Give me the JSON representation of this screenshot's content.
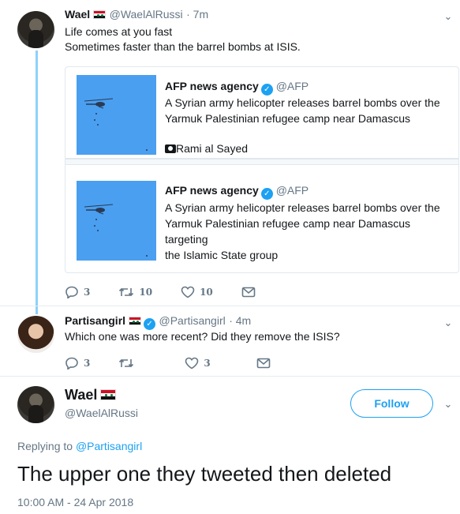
{
  "tweet1": {
    "name": "Wael",
    "handle": "@WaelAlRussi",
    "time": "· 7m",
    "lines": [
      "Life comes at you fast",
      "Sometimes faster than the barrel bombs at ISIS."
    ],
    "actions": {
      "reply": "3",
      "retweet": "10",
      "like": "10"
    }
  },
  "embed": {
    "card1": {
      "name": "AFP news agency",
      "handle": "@AFP",
      "lines": [
        "A Syrian army helicopter releases barrel bombs over the",
        "Yarmuk Palestinian refugee camp near Damascus"
      ],
      "credit": "Rami al Sayed"
    },
    "card2": {
      "name": "AFP news agency",
      "handle": "@AFP",
      "lines": [
        "A Syrian army helicopter releases barrel bombs over the",
        "Yarmuk Palestinian refugee camp near Damascus targeting",
        "the Islamic State group"
      ]
    }
  },
  "tweet2": {
    "name": "Partisangirl",
    "handle": "@Partisangirl",
    "time": "· 4m",
    "text": "Which one was more recent? Did they remove the ISIS?",
    "actions": {
      "reply": "3",
      "retweet": "",
      "like": "3"
    }
  },
  "tweet3": {
    "name": "Wael",
    "handle": "@WaelAlRussi",
    "follow_label": "Follow",
    "replying_prefix": "Replying to",
    "replying_to": "@Partisangirl",
    "text": "The upper one they tweeted then deleted",
    "timestamp": "10:00 AM - 24 Apr 2018"
  },
  "colors": {
    "accent": "#1da1f2",
    "thread_line": "#8ed0f9",
    "muted": "#657786"
  },
  "icons": [
    "reply-icon",
    "retweet-icon",
    "like-icon",
    "dm-icon",
    "chevron-down-icon",
    "camera-icon",
    "verified-badge-icon",
    "syria-flag-icon"
  ]
}
